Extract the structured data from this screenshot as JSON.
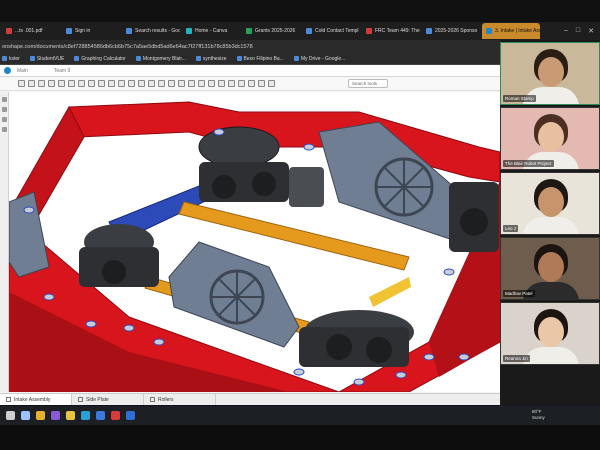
{
  "browser": {
    "tabs": [
      {
        "label": "...ts .001.pdf",
        "color": "#d03b3b",
        "active": false
      },
      {
        "label": "Sign in",
        "color": "#4a8ad8",
        "active": false
      },
      {
        "label": "Search results - Goo",
        "color": "#4a8ad8",
        "active": false
      },
      {
        "label": "Home - Canva",
        "color": "#20b3c2",
        "active": false
      },
      {
        "label": "Grants 2025-2026",
        "color": "#23a35a",
        "active": false
      },
      {
        "label": "Cold Contact Templ",
        "color": "#4a8ad8",
        "active": false
      },
      {
        "label": "FRC Team 449: The",
        "color": "#d03b3b",
        "active": false
      },
      {
        "label": "2025-2026 Sponso",
        "color": "#4a8ad8",
        "active": false
      },
      {
        "label": "3. Intake | Intake Assem",
        "color": "#1d87c9",
        "active": true
      }
    ],
    "url": "onshape.com/documents/c8ef728854586db6cb6b75c7a5ae5dbd5ad6e64ac7f27ff131b78c85b3dc1578",
    "bookmarks": [
      "kster",
      "StudentVUE",
      "Graphing Calculator",
      "Montgomery Blair...",
      "synthesize",
      "Bexo Filipino Ba...",
      "My Drive - Google..."
    ]
  },
  "onshape": {
    "header_left": "Main",
    "header_right": "Team 9",
    "search_tools": "Search tools",
    "bottom_tabs": [
      {
        "label": "Intake Assembly",
        "active": true
      },
      {
        "label": "Side Plate",
        "active": false
      },
      {
        "label": "Rollers",
        "active": false
      }
    ],
    "colors": {
      "frame_red": "#d8141c",
      "plate_gray": "#6f7e92",
      "rail_orange": "#e59a1d",
      "channel_blue": "#2d4bb8"
    }
  },
  "meeting": {
    "participants": [
      {
        "name": "Roman Stamp",
        "bg": "#c9b89a",
        "skin": "#c99a74",
        "hair": "#2a1d14"
      },
      {
        "name": "The Blair Robot Project",
        "bg": "#e4b9b2",
        "skin": "#e7c0a0",
        "hair": "#4a2f22"
      },
      {
        "name": "Leo J",
        "bg": "#e9e4da",
        "skin": "#c8946c",
        "hair": "#1e1712"
      },
      {
        "name": "Madhav Patel",
        "bg": "#6e5c4c",
        "skin": "#b07a58",
        "hair": "#1b1410"
      },
      {
        "name": "Reanna Jin",
        "bg": "#dad3cc",
        "skin": "#e9c7a7",
        "hair": "#1c1511"
      }
    ]
  },
  "taskbar": {
    "icons": [
      {
        "name": "search-icon",
        "color": "#cfcfcf"
      },
      {
        "name": "task-view-icon",
        "color": "#9cc2ff"
      },
      {
        "name": "chrome-icon",
        "color": "#e6b32f"
      },
      {
        "name": "copilot-icon",
        "color": "#8a5bd8"
      },
      {
        "name": "file-explorer-icon",
        "color": "#e8c240"
      },
      {
        "name": "edge-icon",
        "color": "#2aa0d8"
      },
      {
        "name": "store-icon",
        "color": "#3b7be0"
      },
      {
        "name": "app-icon",
        "color": "#d83b3b"
      },
      {
        "name": "mail-icon",
        "color": "#2d6fd6"
      }
    ],
    "weather_temp": "80°F",
    "weather_desc": "Sunny"
  }
}
